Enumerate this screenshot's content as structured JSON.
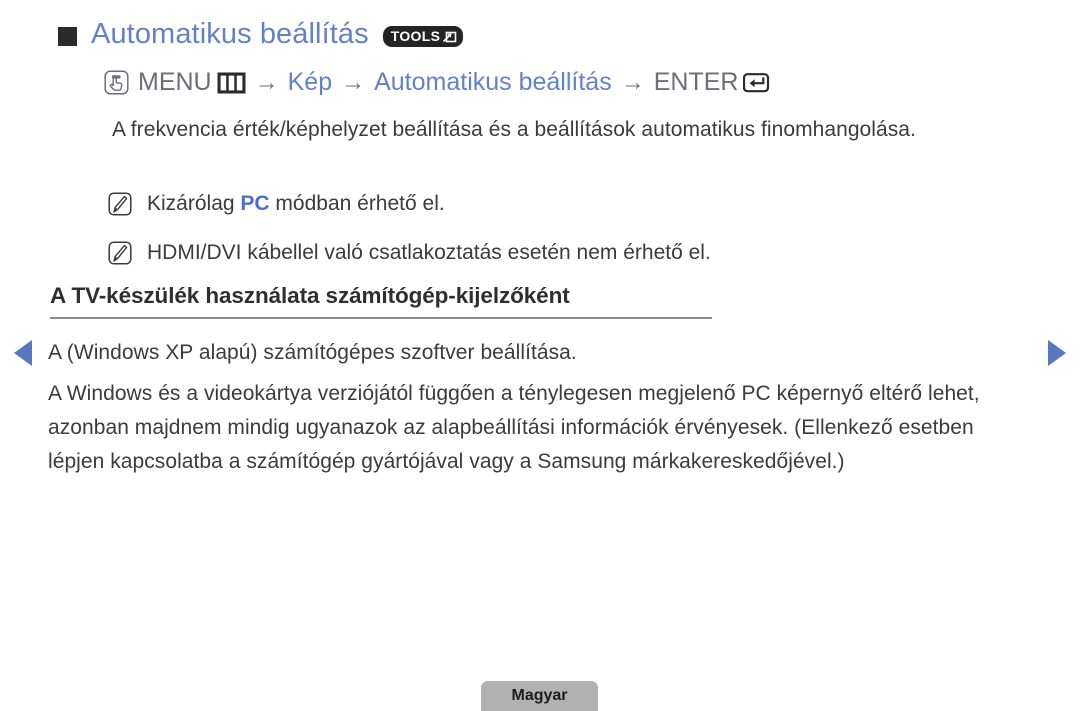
{
  "title": {
    "bullet": "square-bullet",
    "text": "Automatikus beállítás",
    "badge_label": "TOOLS",
    "badge_icon": "tools-arrow-icon",
    "accent_color": "#6381c8"
  },
  "menu_path": {
    "press_icon": "press-button-icon",
    "menu_label": "MENU",
    "menu_icon": "menu-grid-icon",
    "arrow1": "→",
    "segment_kep": "Kép",
    "arrow2": "→",
    "segment_auto": "Automatikus beállítás",
    "arrow3": "→",
    "enter_label": "ENTER",
    "enter_icon": "enter-return-icon"
  },
  "description": "A frekvencia érték/képhelyzet beállítása és a beállítások automatikus finomhangolása.",
  "notes": [
    {
      "icon": "note-pen-icon",
      "prefix": "Kizárólag ",
      "highlight": "PC",
      "suffix": " módban érhető el."
    },
    {
      "icon": "note-pen-icon",
      "prefix": "HDMI/DVI kábellel való csatlakoztatás esetén nem érhető el.",
      "highlight": "",
      "suffix": ""
    }
  ],
  "section": {
    "heading": "A TV-készülék használata számítógép-kijelzőként",
    "line_xp": "A (Windows XP alapú) számítógépes szoftver beállítása.",
    "paragraph": "A Windows és a videokártya verziójától függően a ténylegesen megjelenő PC képernyő eltérő lehet, azonban majdnem mindig ugyanazok az alapbeállítási információk érvényesek. (Ellenkező esetben lépjen kapcsolatba a számítógép gyártójával vagy a Samsung márkakereskedőjével.)"
  },
  "navigation": {
    "prev_icon": "prev-arrow-icon",
    "next_icon": "next-arrow-icon",
    "arrow_color": "#5878bf"
  },
  "footer": {
    "language_label": "Magyar"
  }
}
